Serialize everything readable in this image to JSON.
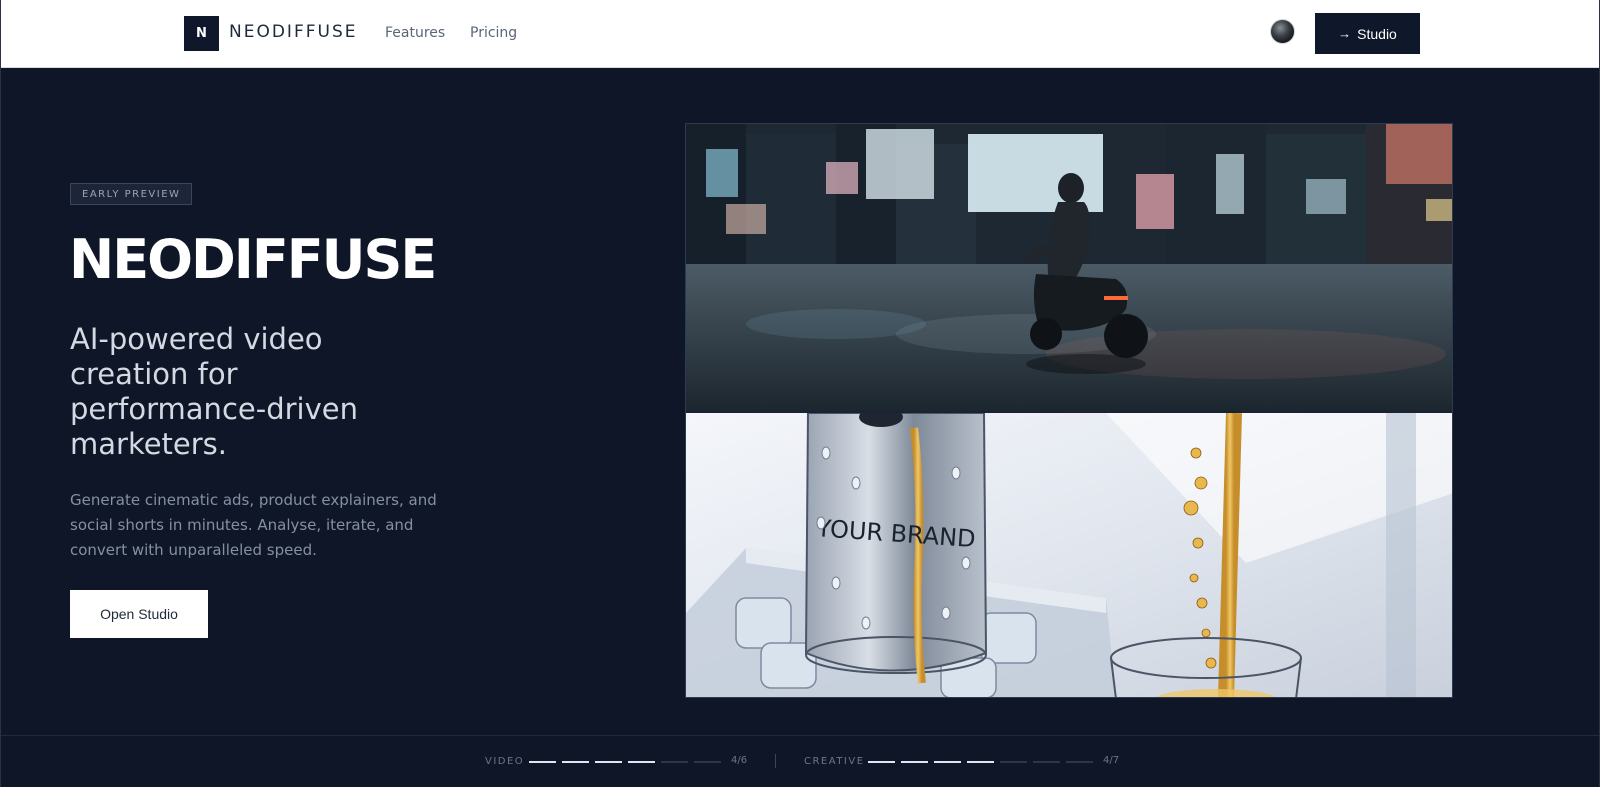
{
  "header": {
    "logo_letter": "N",
    "brand": "NEODIFFUSE",
    "nav": [
      {
        "label": "Features"
      },
      {
        "label": "Pricing"
      }
    ],
    "studio_button": {
      "icon": "arrow-right-icon",
      "label": "Studio"
    }
  },
  "hero": {
    "badge": "EARLY PREVIEW",
    "title": "NEODIFFUSE",
    "subtitle": "AI-powered video creation for performance-driven marketers.",
    "description": "Generate cinematic ads, product explainers, and social shorts in minutes. Analyse, iterate, and convert with unparalleled speed.",
    "cta": "Open Studio"
  },
  "media": {
    "top_scene": "motorcycle-city-night-image",
    "bottom_scene": {
      "can_text": "YOUR BRAND"
    }
  },
  "progress": [
    {
      "label": "VIDEO",
      "current": 4,
      "total": 6,
      "count_text": "4/6"
    },
    {
      "label": "CREATIVE",
      "current": 4,
      "total": 7,
      "count_text": "4/7"
    }
  ],
  "colors": {
    "background": "#0e1628",
    "header_bg": "#ffffff",
    "primary_dark": "#0f172a",
    "text_light": "#ffffff",
    "text_muted": "#8490a3"
  }
}
